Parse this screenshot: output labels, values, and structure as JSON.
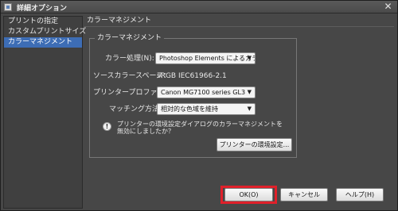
{
  "window": {
    "title": "詳細オプション",
    "close_glyph": "✕"
  },
  "sidebar": {
    "items": [
      {
        "label": "プリントの指定",
        "selected": false
      },
      {
        "label": "カスタムプリントサイズ",
        "selected": false
      },
      {
        "label": "カラーマネジメント",
        "selected": true
      }
    ]
  },
  "panel": {
    "title": "カラーマネジメント",
    "group_title": "カラーマネジメント",
    "color_handling": {
      "label": "カラー処理(N):",
      "value": "Photoshop Elements によるカラ～"
    },
    "source_space": {
      "label": "ソースカラースペース：",
      "value": "sRGB IEC61966-2.1"
    },
    "printer_profile": {
      "label": "プリンタープロファイル：",
      "value": "Canon MG7100 series GL3"
    },
    "matching": {
      "label": "マッチング方法：",
      "value": "相対的な色域を維持"
    },
    "note": {
      "icon": "!",
      "text": "プリンターの環境設定ダイアログのカラーマネジメントを無効にしましたか？"
    },
    "printer_prefs_button": "プリンターの環境設定..."
  },
  "footer": {
    "ok_label": "OK(O)",
    "cancel_label": "キャンセル",
    "help_label": "ヘルプ(H)",
    "highlight_color": "#e0202a"
  }
}
